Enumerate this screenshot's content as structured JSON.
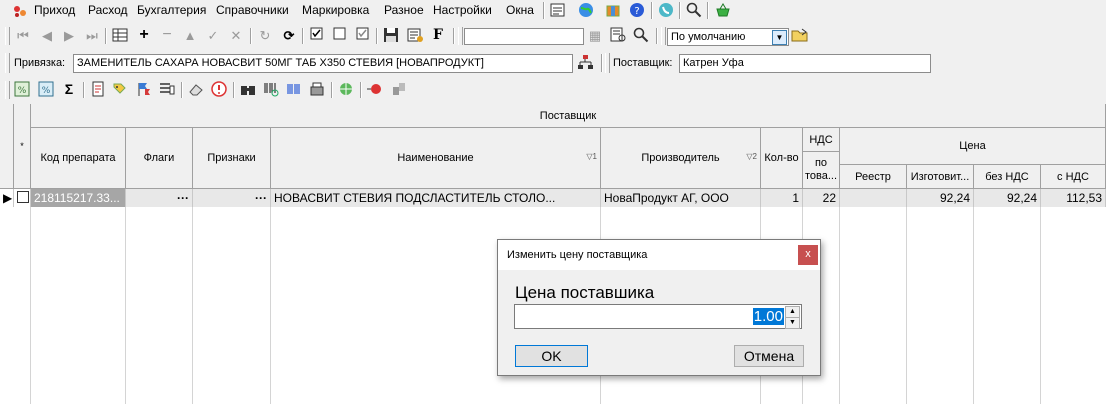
{
  "menu": {
    "items": [
      "Приход",
      "Расход",
      "Бухгалтерия",
      "Справочники",
      "Маркировка",
      "Разное",
      "Настройки",
      "Окна"
    ]
  },
  "toolbar2": {
    "search_value": "",
    "sort_select": "По умолчанию"
  },
  "binding": {
    "label": "Привязка:",
    "value": "ЗАМЕНИТЕЛЬ САХАРА НОВАСВИТ 50МГ ТАБ Х350 СТЕВИЯ [НОВАПРОДУКТ]"
  },
  "supplier_field": {
    "label": "Поставщик:",
    "value": "Катрен Уфа"
  },
  "grid": {
    "group_header": "Поставщик",
    "nds_group": "НДС",
    "price_group": "Цена",
    "columns": {
      "code": "Код препарата",
      "flags": "Флаги",
      "signs": "Признаки",
      "name": "Наименование",
      "name_sort": "▽1",
      "manufacturer": "Производитель",
      "manufacturer_sort": "▽2",
      "qty": "Кол-во",
      "nds_sub": "по това...",
      "registry": "Реестр",
      "maker_price": "Изготовит...",
      "no_nds": "без НДС",
      "with_nds": "с НДС"
    },
    "rows": [
      {
        "code": "218115217.33...",
        "flags": "···",
        "signs": "···",
        "name": "НОВАСВИТ СТЕВИЯ ПОДСЛАСТИТЕЛЬ СТОЛО...",
        "manufacturer": "НоваПродукт АГ, ООО",
        "qty": "1",
        "nds": "22",
        "registry": "",
        "maker_price": "92,24",
        "no_nds": "92,24",
        "with_nds": "112,53"
      }
    ]
  },
  "dialog": {
    "title": "Изменить цену поставщика",
    "field_label": "Цена поставшика",
    "value": "1.00",
    "ok": "OK",
    "cancel": "Отмена"
  },
  "colors": {
    "selection": "#0078d7",
    "close_button": "#c75050"
  }
}
